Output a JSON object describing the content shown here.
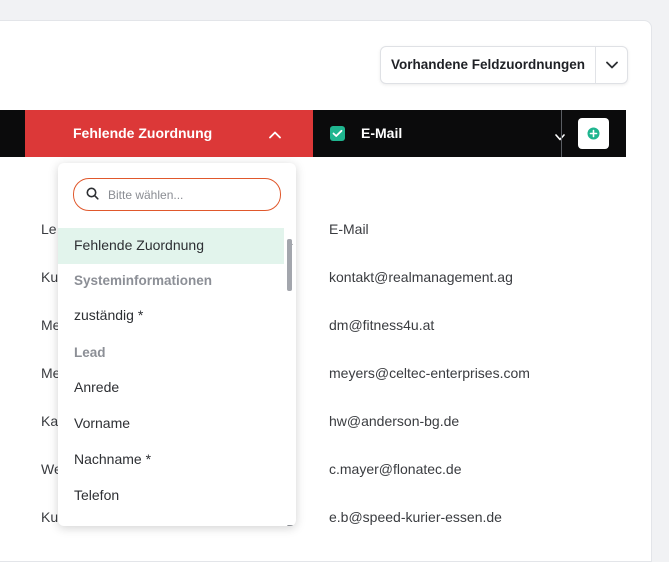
{
  "mapping_button": {
    "label": "Vorhandene Feldzuordnungen"
  },
  "header": {
    "missing_label": "Fehlende Zuordnung",
    "email_label": "E-Mail"
  },
  "rows": [
    {
      "left": "Le",
      "right": "E-Mail"
    },
    {
      "left": "Ku",
      "right": "kontakt@realmanagement.ag"
    },
    {
      "left": "Me",
      "right": "dm@fitness4u.at"
    },
    {
      "left": "Me",
      "right": "meyers@celtec-enterprises.com"
    },
    {
      "left": "Ka",
      "right": "hw@anderson-bg.de"
    },
    {
      "left": "We",
      "right": "c.mayer@flonatec.de"
    },
    {
      "left": "Ku",
      "right": "e.b@speed-kurier-essen.de"
    }
  ],
  "dropdown": {
    "search_placeholder": "Bitte wählen...",
    "selected": "Fehlende Zuordnung",
    "group_system": "Systeminformationen",
    "opt_zustaendig": "zuständig *",
    "group_lead": "Lead",
    "opt_anrede": "Anrede",
    "opt_vorname": "Vorname",
    "opt_nachname": "Nachname *",
    "opt_telefon": "Telefon"
  },
  "colors": {
    "accent_red": "#dc3838",
    "header_black": "#0b0b0c",
    "checkbox_green": "#1fb58f",
    "selected_bg": "#e2f4ec",
    "search_border": "#e0582c"
  },
  "icons": {
    "search": "search-icon",
    "chevron_down": "chevron-down-icon",
    "chevron_up": "chevron-up-icon",
    "check": "check-icon",
    "plus": "plus-circle-icon"
  }
}
